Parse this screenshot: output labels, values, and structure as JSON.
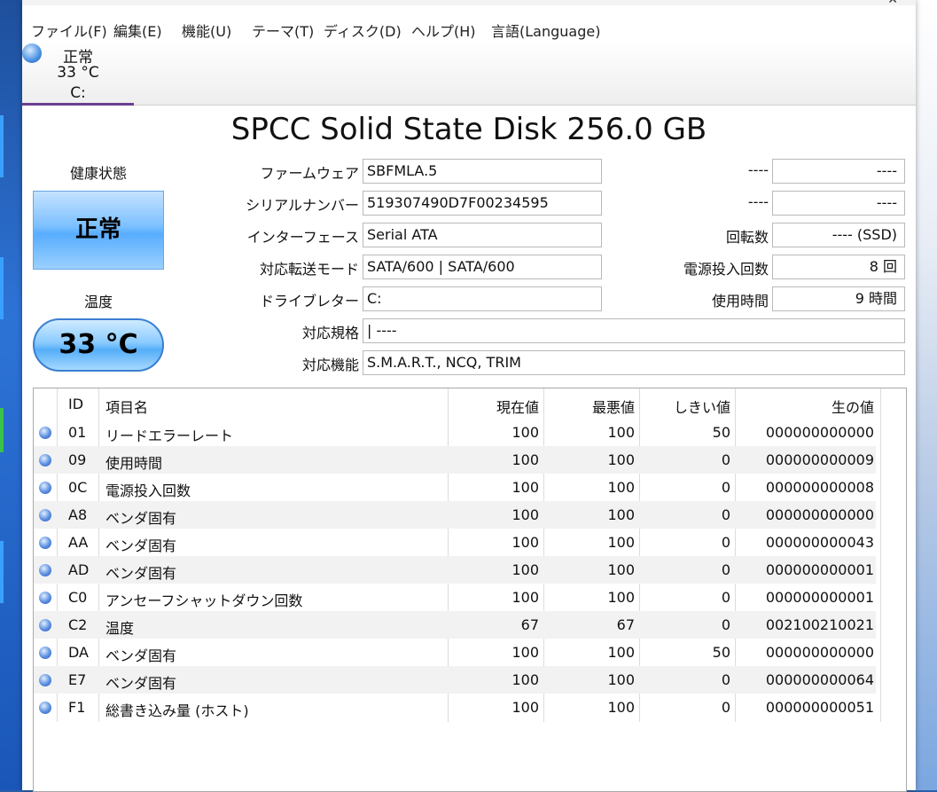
{
  "menu": [
    "ファイル(F)",
    "編集(E)",
    "機能(U)",
    "テーマ(T)",
    "ディスク(D)",
    "ヘルプ(H)",
    "言語(Language)"
  ],
  "disk_tab": {
    "status": "正常",
    "temp": "33 °C",
    "drive": "C:"
  },
  "model": "SPCC Solid State Disk 256.0 GB",
  "left": {
    "health_label": "健康状態",
    "health_value": "正常",
    "temp_label": "温度",
    "temp_value": "33 °C"
  },
  "info": {
    "firmware": {
      "label": "ファームウェア",
      "value": "SBFMLA.5"
    },
    "serial": {
      "label": "シリアルナンバー",
      "value": "519307490D7F00234595"
    },
    "interface": {
      "label": "インターフェース",
      "value": "Serial ATA"
    },
    "transfer": {
      "label": "対応転送モード",
      "value": "SATA/600 | SATA/600"
    },
    "drive_letter": {
      "label": "ドライブレター",
      "value": "C:"
    },
    "standard": {
      "label": "対応規格",
      "value": " | ----"
    },
    "features": {
      "label": "対応機能",
      "value": "S.M.A.R.T., NCQ, TRIM"
    },
    "r1": {
      "label": "----",
      "value": "----"
    },
    "r2": {
      "label": "----",
      "value": "----"
    },
    "rotation": {
      "label": "回転数",
      "value": "---- (SSD)"
    },
    "power_count": {
      "label": "電源投入回数",
      "value": "8 回"
    },
    "power_hours": {
      "label": "使用時間",
      "value": "9 時間"
    }
  },
  "smart": {
    "headers": {
      "id": "ID",
      "name": "項目名",
      "current": "現在値",
      "worst": "最悪値",
      "threshold": "しきい値",
      "raw": "生の値"
    },
    "rows": [
      {
        "id": "01",
        "name": "リードエラーレート",
        "current": "100",
        "worst": "100",
        "threshold": "50",
        "raw": "000000000000"
      },
      {
        "id": "09",
        "name": "使用時間",
        "current": "100",
        "worst": "100",
        "threshold": "0",
        "raw": "000000000009"
      },
      {
        "id": "0C",
        "name": "電源投入回数",
        "current": "100",
        "worst": "100",
        "threshold": "0",
        "raw": "000000000008"
      },
      {
        "id": "A8",
        "name": "ベンダ固有",
        "current": "100",
        "worst": "100",
        "threshold": "0",
        "raw": "000000000000"
      },
      {
        "id": "AA",
        "name": "ベンダ固有",
        "current": "100",
        "worst": "100",
        "threshold": "0",
        "raw": "000000000043"
      },
      {
        "id": "AD",
        "name": "ベンダ固有",
        "current": "100",
        "worst": "100",
        "threshold": "0",
        "raw": "000000000001"
      },
      {
        "id": "C0",
        "name": "アンセーフシャットダウン回数",
        "current": "100",
        "worst": "100",
        "threshold": "0",
        "raw": "000000000001"
      },
      {
        "id": "C2",
        "name": "温度",
        "current": "67",
        "worst": "67",
        "threshold": "0",
        "raw": "002100210021"
      },
      {
        "id": "DA",
        "name": "ベンダ固有",
        "current": "100",
        "worst": "100",
        "threshold": "50",
        "raw": "000000000000"
      },
      {
        "id": "E7",
        "name": "ベンダ固有",
        "current": "100",
        "worst": "100",
        "threshold": "0",
        "raw": "000000000064"
      },
      {
        "id": "F1",
        "name": "総書き込み量 (ホスト)",
        "current": "100",
        "worst": "100",
        "threshold": "0",
        "raw": "000000000051"
      }
    ]
  }
}
